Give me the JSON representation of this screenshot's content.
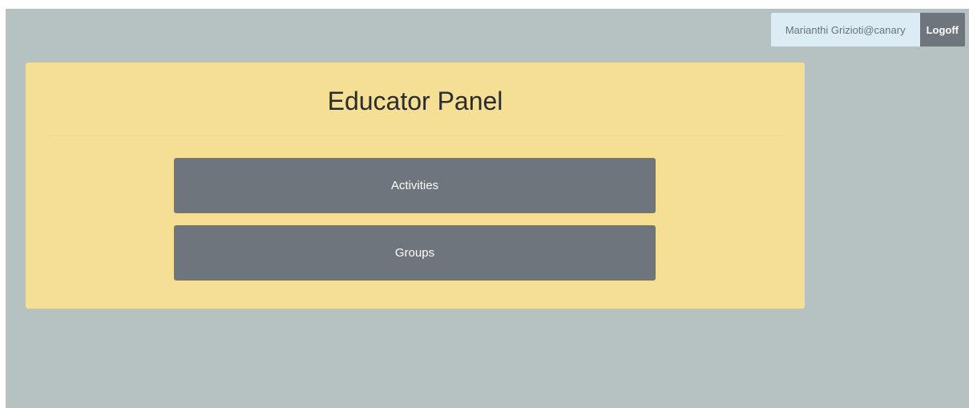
{
  "header": {
    "user": "Marianthi Grizioti@canary",
    "logoff_label": "Logoff"
  },
  "panel": {
    "title": "Educator Panel",
    "buttons": [
      {
        "label": "Activities"
      },
      {
        "label": "Groups"
      }
    ]
  },
  "colors": {
    "page_background": "#b5c2c1",
    "panel_background": "#f4df95",
    "button_background": "#6e757c",
    "user_badge_background": "#dcecf4"
  }
}
